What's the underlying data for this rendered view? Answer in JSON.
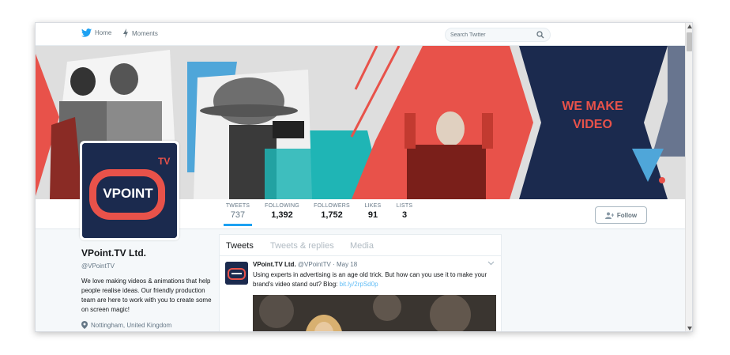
{
  "nav": {
    "home_label": "Home",
    "moments_label": "Moments",
    "search_placeholder": "Search Twitter"
  },
  "banner": {
    "headline_line1": "WE MAKE",
    "headline_line2": "VIDEO"
  },
  "stats": [
    {
      "label": "TWEETS",
      "value": "737"
    },
    {
      "label": "FOLLOWING",
      "value": "1,392"
    },
    {
      "label": "FOLLOWERS",
      "value": "1,752"
    },
    {
      "label": "LIKES",
      "value": "91"
    },
    {
      "label": "LISTS",
      "value": "3"
    }
  ],
  "follow_label": "Follow",
  "avatar": {
    "brand_text": "VPOINT",
    "tv_text": "TV"
  },
  "profile": {
    "name": "VPoint.TV Ltd.",
    "handle": "@VPointTV",
    "bio": "We love making videos & animations that help people realise ideas. Our friendly production team are here to work with you to create some on screen magic!",
    "location": "Nottingham, United Kingdom"
  },
  "timeline": {
    "tabs": [
      "Tweets",
      "Tweets & replies",
      "Media"
    ],
    "tweet": {
      "author": "VPoint.TV Ltd.",
      "handle": "@VPointTV",
      "separator": "·",
      "date": "May 18",
      "text": "Using experts in advertising is an age old trick. But how can you use it to make your brand's video stand out? Blog: ",
      "link": "bit.ly/2rpSd0p"
    }
  },
  "colors": {
    "accent": "#1da1f2",
    "brand_navy": "#1b2a4e",
    "brand_red": "#e8524a",
    "brand_teal": "#1fb5b5"
  }
}
